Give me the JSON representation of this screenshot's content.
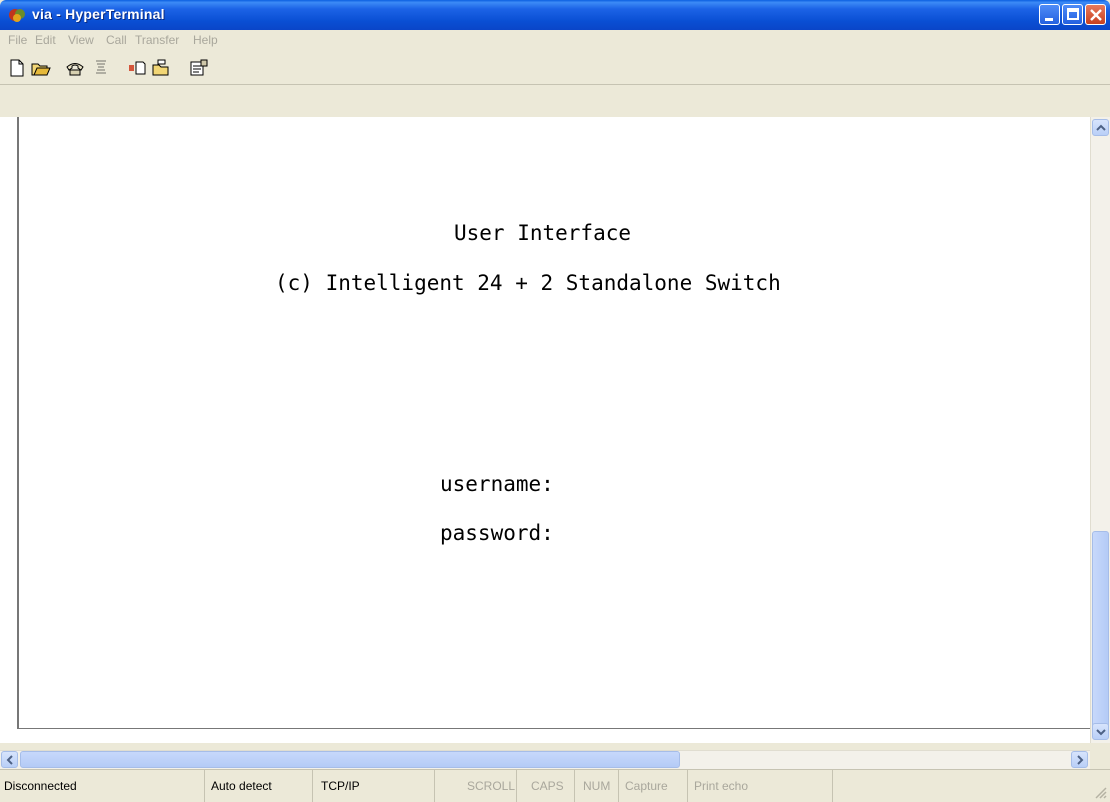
{
  "window": {
    "title": "via - HyperTerminal"
  },
  "menu": [
    "File",
    "Edit",
    "View",
    "Call",
    "Transfer",
    "Help"
  ],
  "toolbar": {
    "icons": [
      "new-icon",
      "open-icon",
      "call-icon",
      "disconnect-icon",
      "send-icon",
      "receive-icon",
      "properties-icon"
    ]
  },
  "terminal": {
    "lines": [
      "User Interface",
      "(c) Intelligent 24 + 2 Standalone Switch",
      "username:",
      "password:"
    ]
  },
  "status": {
    "items": [
      "Disconnected",
      "Auto detect",
      "TCP/IP",
      "SCROLL",
      "CAPS",
      "NUM",
      "Capture",
      "Print echo"
    ]
  },
  "colors": {
    "titlebar": "#0a4fd4",
    "close_button": "#c8401f",
    "chrome": "#ece9d8",
    "terminal_bg": "#ffffff"
  }
}
